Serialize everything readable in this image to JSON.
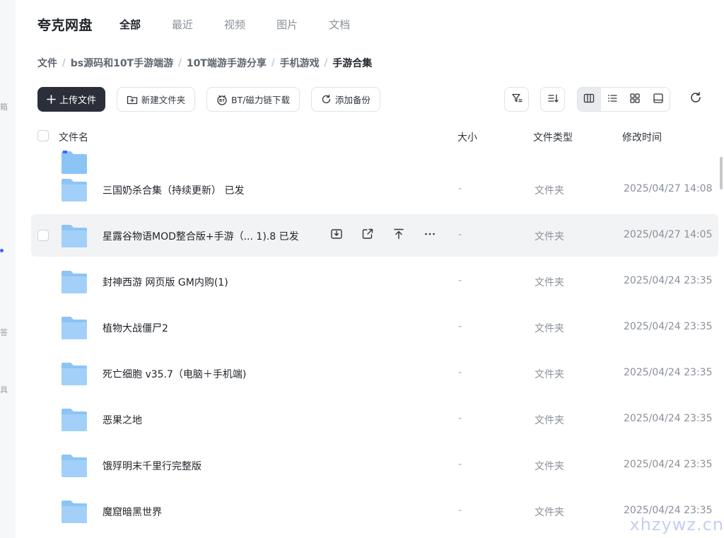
{
  "app": {
    "logo": "夸克网盘"
  },
  "tabs": [
    {
      "label": "全部",
      "active": true
    },
    {
      "label": "最近",
      "active": false
    },
    {
      "label": "视频",
      "active": false
    },
    {
      "label": "图片",
      "active": false
    },
    {
      "label": "文档",
      "active": false
    }
  ],
  "breadcrumb": [
    "文件",
    "bs源码和10T手游端游",
    "10T端游手游分享",
    "手机游戏",
    "手游合集"
  ],
  "toolbar": {
    "upload": "上传文件",
    "new_folder": "新建文件夹",
    "bt_download": "BT/磁力链下载",
    "add_backup": "添加备份"
  },
  "columns": {
    "name": "文件名",
    "size": "大小",
    "type": "文件类型",
    "modified": "修改时间"
  },
  "files": [
    {
      "name": "三国奶杀合集（持续更新） 已发",
      "size": "-",
      "type": "文件夹",
      "modified": "2025/04/27 14:08"
    },
    {
      "name": "星露谷物语MOD整合版+手游（...  1).8 已发",
      "size": "-",
      "type": "文件夹",
      "modified": "2025/04/27 14:05"
    },
    {
      "name": "封神西游 网页版 GM内购(1)",
      "size": "-",
      "type": "文件夹",
      "modified": "2025/04/24 23:35"
    },
    {
      "name": "植物大战僵尸2",
      "size": "-",
      "type": "文件夹",
      "modified": "2025/04/24 23:35"
    },
    {
      "name": "死亡细胞 v35.7（电脑＋手机端)",
      "size": "-",
      "type": "文件夹",
      "modified": "2025/04/24 23:35"
    },
    {
      "name": "恶果之地",
      "size": "-",
      "type": "文件夹",
      "modified": "2025/04/24 23:35"
    },
    {
      "name": "饿殍明末千里行完整版",
      "size": "-",
      "type": "文件夹",
      "modified": "2025/04/24 23:35"
    },
    {
      "name": "魔窟暗黑世界",
      "size": "-",
      "type": "文件夹",
      "modified": "2025/04/24 23:35"
    }
  ],
  "hovered_row_index": 1,
  "side_marks": [
    "箱",
    "答",
    "具"
  ],
  "watermark": "xhzywz.cn",
  "colors": {
    "primary_button": "#2b2f3a",
    "folder": "#8cc4f5",
    "hover_row": "#f2f3f5",
    "accent": "#3d64f5"
  }
}
